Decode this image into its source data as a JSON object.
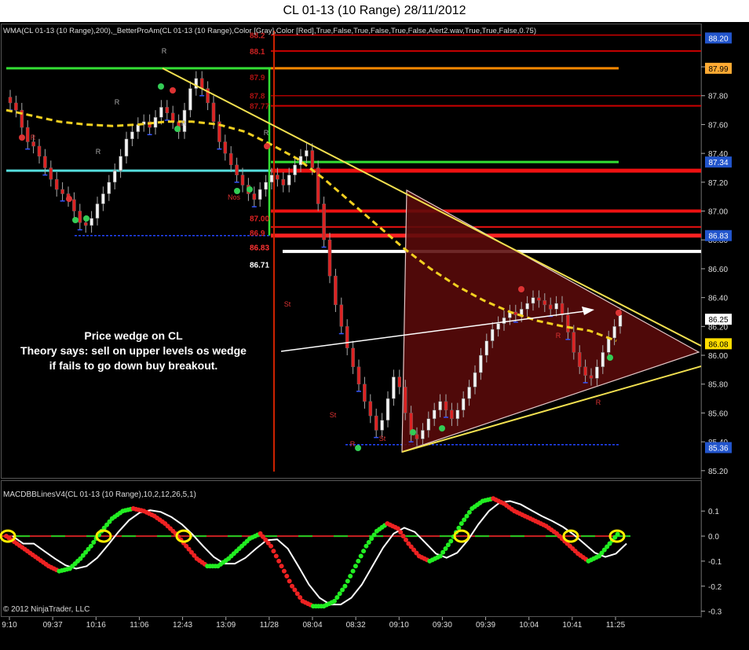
{
  "window": {
    "title": "CL 01-13 (10 Range)  28/11/2012"
  },
  "price_panel": {
    "indicator_label": "WMA(CL 01-13 (10 Range),200),_BetterProAm(CL 01-13 (10 Range),Color [Gray],Color [Red],True,False,True,False,True,False,Alert2.wav,True,True,False,0.75)",
    "annotation": [
      "Price wedge on CL",
      "Theory says: sell on upper levels os wedge",
      "if fails to go down buy breakout."
    ],
    "level_labels": [
      {
        "text": "88.2",
        "price": 88.22,
        "color": "#cc2222"
      },
      {
        "text": "88.1",
        "price": 88.11,
        "color": "#cc2222"
      },
      {
        "text": "87.9",
        "price": 87.93,
        "color": "#aa1111"
      },
      {
        "text": "87.8",
        "price": 87.8,
        "color": "#aa1111"
      },
      {
        "text": "87.77",
        "price": 87.73,
        "color": "#aa1111"
      },
      {
        "text": "87.00",
        "price": 86.95,
        "color": "#dd2222"
      },
      {
        "text": "86.9",
        "price": 86.85,
        "color": "#dd2222"
      },
      {
        "text": "86.83",
        "price": 86.75,
        "color": "#ff3333"
      },
      {
        "text": "86.71",
        "price": 86.63,
        "color": "#ffffff"
      }
    ],
    "signal_labels": [
      "R",
      "R",
      "R",
      "R",
      "R",
      "R",
      "R",
      "R",
      "R",
      "Nos",
      "St",
      "St",
      "St"
    ]
  },
  "chart_data": [
    {
      "type": "candlestick",
      "ylim": [
        85.15,
        88.3
      ],
      "y_ticks": [
        85.2,
        85.4,
        85.6,
        85.8,
        86.0,
        86.2,
        86.4,
        86.6,
        86.8,
        87.0,
        87.2,
        87.4,
        87.6,
        87.8,
        88.0
      ],
      "price_tags": [
        {
          "value": "88.20",
          "price": 88.2,
          "color": "#2255cc"
        },
        {
          "value": "87.99",
          "price": 87.99,
          "color": "#ffaa33"
        },
        {
          "value": "87.34",
          "price": 87.34,
          "color": "#2255cc"
        },
        {
          "value": "86.83",
          "price": 86.83,
          "color": "#2255cc"
        },
        {
          "value": "86.25",
          "price": 86.25,
          "color": "#ffffff"
        },
        {
          "value": "86.08",
          "price": 86.08,
          "color": "#ffdd00"
        },
        {
          "value": "85.36",
          "price": 85.36,
          "color": "#2255cc"
        }
      ],
      "x_labels": [
        "9:10",
        "09:37",
        "10:16",
        "11:06",
        "12:43",
        "13:09",
        "11/28",
        "08:04",
        "08:32",
        "09:10",
        "09:30",
        "09:39",
        "10:04",
        "10:41",
        "11:25"
      ],
      "close": [
        87.75,
        87.7,
        87.58,
        87.48,
        87.45,
        87.38,
        87.3,
        87.22,
        87.15,
        87.12,
        87.08,
        87.0,
        86.92,
        86.9,
        86.95,
        87.05,
        87.12,
        87.2,
        87.28,
        87.38,
        87.5,
        87.55,
        87.6,
        87.62,
        87.58,
        87.65,
        87.72,
        87.68,
        87.62,
        87.55,
        87.7,
        87.85,
        87.92,
        87.85,
        87.75,
        87.62,
        87.48,
        87.4,
        87.32,
        87.25,
        87.18,
        87.12,
        87.08,
        87.15,
        87.2,
        87.25,
        87.22,
        87.18,
        87.25,
        87.32,
        87.38,
        87.42,
        87.3,
        87.05,
        86.8,
        86.55,
        86.35,
        86.2,
        86.05,
        85.92,
        85.8,
        85.68,
        85.58,
        85.48,
        85.55,
        85.7,
        85.85,
        85.78,
        85.6,
        85.45,
        85.42,
        85.48,
        85.56,
        85.62,
        85.68,
        85.62,
        85.56,
        85.62,
        85.7,
        85.78,
        85.88,
        86.0,
        86.1,
        86.18,
        86.22,
        86.26,
        86.3,
        86.28,
        86.32,
        86.36,
        86.4,
        86.38,
        86.35,
        86.32,
        86.36,
        86.28,
        86.16,
        86.02,
        85.92,
        85.86,
        85.84,
        85.92,
        86.02,
        86.12,
        86.2,
        86.28
      ],
      "wma": [
        87.7,
        87.66,
        87.62,
        87.6,
        87.59,
        87.6,
        87.62,
        87.62,
        87.6,
        87.55,
        87.46,
        87.36,
        87.22,
        87.06,
        86.9,
        86.74,
        86.6,
        86.48,
        86.38,
        86.3,
        86.24,
        86.2,
        86.17,
        86.1
      ]
    },
    {
      "type": "macd",
      "label": "MACDBBLinesV4(CL 01-13 (10 Range),10,2,12,26,5,1)",
      "ylim": [
        -0.32,
        0.22
      ],
      "y_ticks": [
        0.1,
        0.0,
        -0.1,
        -0.2,
        -0.3
      ],
      "macd": [
        0.0,
        -0.03,
        -0.06,
        -0.09,
        -0.12,
        -0.14,
        -0.13,
        -0.09,
        -0.04,
        0.02,
        0.07,
        0.1,
        0.11,
        0.1,
        0.08,
        0.05,
        0.01,
        -0.04,
        -0.09,
        -0.12,
        -0.12,
        -0.09,
        -0.05,
        -0.01,
        0.01,
        -0.04,
        -0.12,
        -0.2,
        -0.26,
        -0.28,
        -0.28,
        -0.26,
        -0.2,
        -0.12,
        -0.04,
        0.02,
        0.05,
        0.03,
        -0.03,
        -0.08,
        -0.1,
        -0.08,
        -0.02,
        0.05,
        0.11,
        0.14,
        0.15,
        0.13,
        0.1,
        0.08,
        0.06,
        0.04,
        0.01,
        -0.03,
        -0.07,
        -0.1,
        -0.08,
        -0.03,
        0.02
      ]
    }
  ],
  "footer": {
    "copyright": "© 2012 NinjaTrader, LLC"
  }
}
